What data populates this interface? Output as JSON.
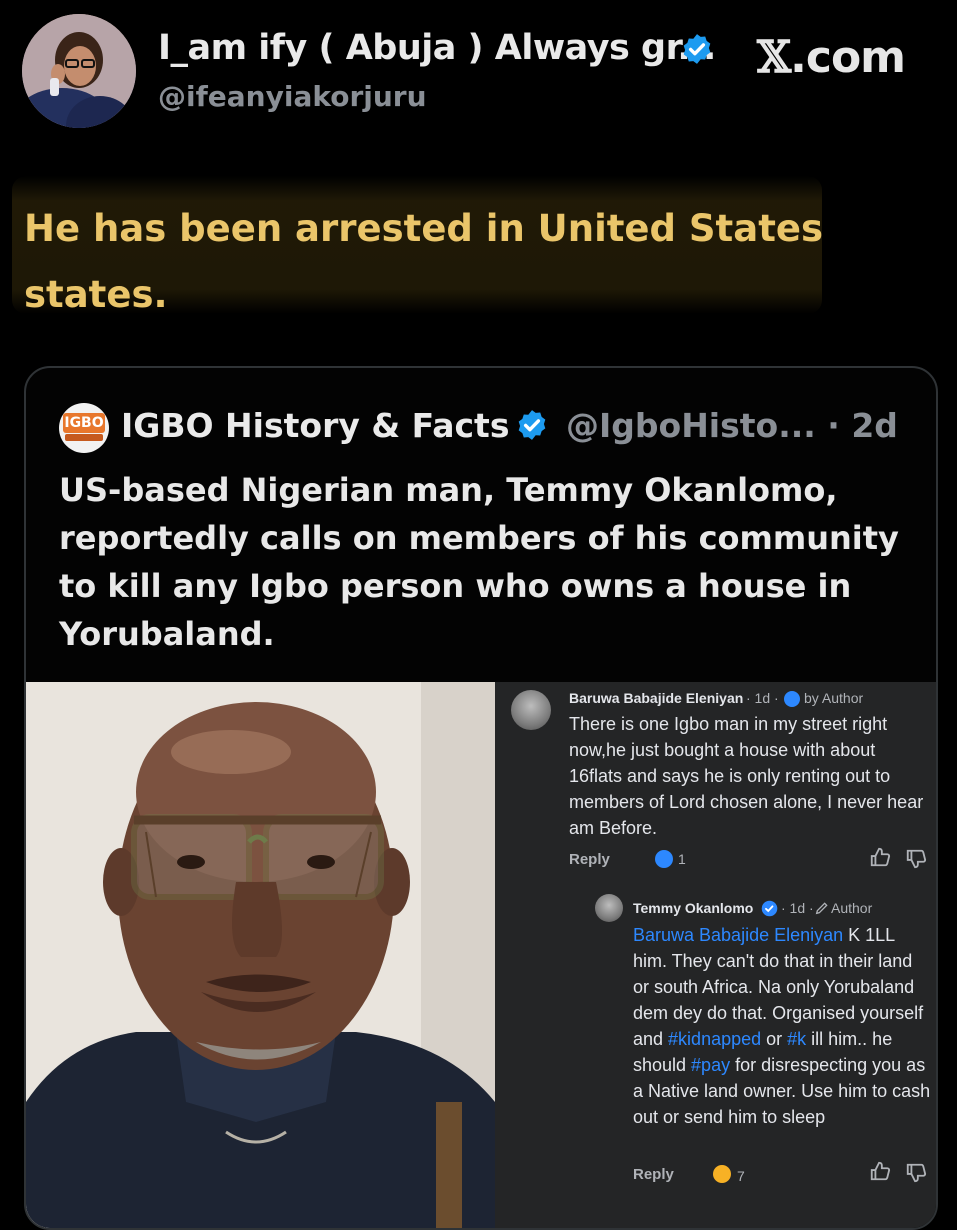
{
  "header": {
    "display_name": "I_am ify ( Abuja ) Always gr...",
    "handle": "@ifeanyiakorjuru",
    "brand_x": "𝕏",
    "brand_suffix": ".com",
    "verified_icon": "verified-badge-icon"
  },
  "post": {
    "text": "He has been arrested in United States states."
  },
  "quote": {
    "name": "IGBO History & Facts",
    "logo_text": "IGBO",
    "handle_time": "@IgboHisto... · 2d",
    "text": "US-based Nigerian man, Temmy Okanlomo, reportedly calls on members of his community to kill any Igbo person who owns a house in Yorubaland."
  },
  "comments": [
    {
      "name": "Baruwa Babajide Eleniyan",
      "time": "· 1d ·",
      "badge": "by Author",
      "body": "There is one Igbo man in my street right now,he just bought a house with about 16flats and says he is only renting out to members of Lord chosen alone, I never hear am Before.",
      "reply_label": "Reply",
      "reaction_count": "1"
    },
    {
      "name": "Temmy Okanlomo",
      "time": "· 1d ·",
      "badge": "Author",
      "mention": "Baruwa Babajide Eleniyan",
      "body_part1": " K 1LL him. They can't do that in their land or south Africa. Na only Yorubaland dem dey do that. Organised yourself and ",
      "tag1": "#kidnapped",
      "body_part2": " or ",
      "tag2": "#k",
      "body_part3": " ill him.. he should ",
      "tag3": "#pay",
      "body_part4": " for disrespecting you as a Native land owner. Use him to cash out or send him to sleep",
      "reply_label": "Reply",
      "reaction_count": "7"
    }
  ],
  "colors": {
    "highlight_text": "#eac56a",
    "link_blue": "#2d88ff",
    "verified_blue": "#1d9bf0"
  }
}
